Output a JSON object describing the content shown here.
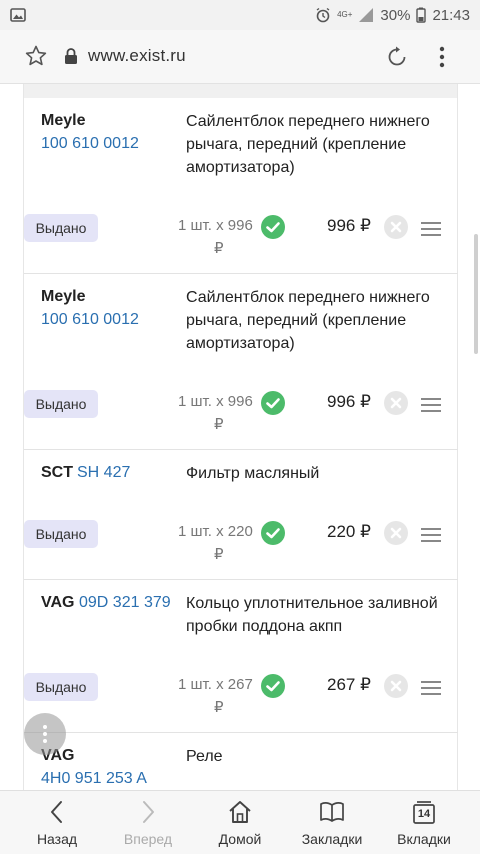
{
  "statusbar": {
    "network": "4G+",
    "battery": "30%",
    "time": "21:43",
    "icons": [
      "image-icon",
      "alarm-icon",
      "signal-icon",
      "battery-icon"
    ]
  },
  "addressbar": {
    "url": "www.exist.ru",
    "icons": [
      "star-icon",
      "lock-icon",
      "reload-icon",
      "more-vert-icon"
    ]
  },
  "orders": [
    {
      "brand": "Meyle",
      "part_number": "100 610 0012",
      "description": "Сайлентблок переднего нижнего рычага, передний (крепление амортизатора)",
      "status": "Выдано",
      "qty_text": "1 шт. x 996",
      "currency": "₽",
      "price": "996 ₽"
    },
    {
      "brand": "Meyle",
      "part_number": "100 610 0012",
      "description": "Сайлентблок переднего нижнего рычага, передний (крепление амортизатора)",
      "status": "Выдано",
      "qty_text": "1 шт. x 996",
      "currency": "₽",
      "price": "996 ₽"
    },
    {
      "brand": "SCT",
      "part_number": "SH 427",
      "description": "Фильтр масляный",
      "status": "Выдано",
      "qty_text": "1 шт. x 220",
      "currency": "₽",
      "price": "220 ₽"
    },
    {
      "brand": "VAG",
      "part_number": "09D 321 379",
      "description": "Кольцо уплотнительное заливной пробки поддона акпп",
      "status": "Выдано",
      "qty_text": "1 шт. x 267",
      "currency": "₽",
      "price": "267 ₽"
    },
    {
      "brand": "VAG",
      "part_number": "4H0 951 253 A",
      "description": "Реле"
    }
  ],
  "bottombar": {
    "back": "Назад",
    "forward": "Вперед",
    "home": "Домой",
    "bookmarks": "Закладки",
    "tabs": "Вкладки",
    "tabs_count": "14"
  },
  "colors": {
    "link": "#2a6fb0",
    "badge_bg": "#e4e4f7",
    "check": "#4cbb6a",
    "xbtn": "#e6e6e6"
  }
}
